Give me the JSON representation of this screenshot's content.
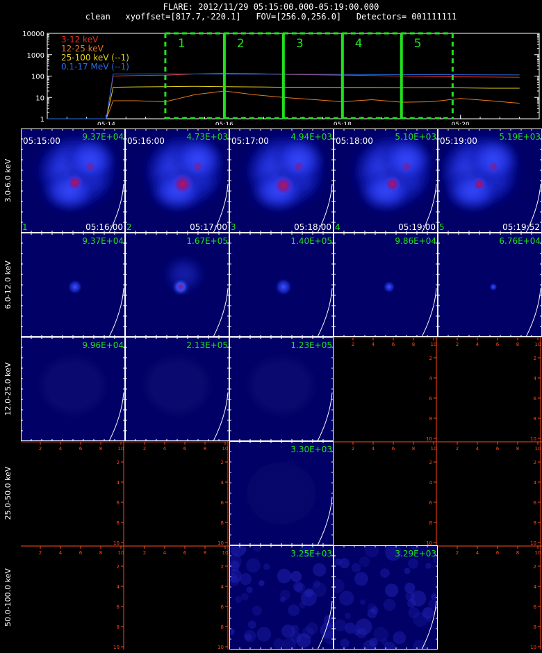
{
  "header": {
    "title_line": "FLARE: 2012/11/29 05:15:00.000-05:19:00.000",
    "info_line": "clean   xyoffset=[817.7,-220.1]   FOV=[256.0,256.0]   Detectors= 001111111"
  },
  "lightcurve": {
    "legend": [
      {
        "label": "3-12 keV",
        "color": "#e8301e"
      },
      {
        "label": "12-25 keV",
        "color": "#e87a1e"
      },
      {
        "label": "25-100 keV (--1)",
        "color": "#e8d51e"
      },
      {
        "label": "0.1-17 MeV (--1)",
        "color": "#2a6ee8"
      }
    ],
    "y_tick_labels": [
      "10000",
      "1000",
      "100",
      "10",
      "1"
    ],
    "x_tick_labels": [
      "05:14",
      "05:16",
      "05:18",
      "05:20"
    ],
    "interval_labels": [
      "1",
      "2",
      "3",
      "4",
      "5"
    ],
    "interval_color": "#22e01e"
  },
  "chart_data": {
    "type": "line",
    "title": "FLARE: 2012/11/29 05:15:00.000-05:19:00.000",
    "y_scale": "log",
    "ylim": [
      1,
      10000
    ],
    "x_unit": "time (UT)",
    "xlim": [
      "05:13:00",
      "05:21:20"
    ],
    "x": [
      "05:13:00",
      "05:13:30",
      "05:14:00",
      "05:14:07",
      "05:14:30",
      "05:15:00",
      "05:15:30",
      "05:16:00",
      "05:16:30",
      "05:17:00",
      "05:17:30",
      "05:18:00",
      "05:18:30",
      "05:19:00",
      "05:19:30",
      "05:20:00",
      "05:20:30",
      "05:21:00"
    ],
    "series": [
      {
        "name": "3-12 keV",
        "color": "#e8301e",
        "values": [
          1,
          1,
          1,
          100,
          105,
          110,
          125,
          135,
          130,
          120,
          115,
          110,
          105,
          100,
          95,
          92,
          90,
          88
        ]
      },
      {
        "name": "12-25 keV",
        "color": "#e87a1e",
        "values": [
          1,
          1,
          1,
          7,
          7,
          7,
          12,
          20,
          15,
          9,
          8,
          7,
          7,
          6,
          7,
          8,
          7,
          6
        ]
      },
      {
        "name": "25-100 keV (--1)",
        "color": "#e8d51e",
        "values": [
          1,
          1,
          1,
          30,
          31,
          32,
          33,
          32,
          31,
          30,
          30,
          29,
          29,
          28,
          28,
          28,
          27,
          27
        ]
      },
      {
        "name": "0.1-17 MeV (--1)",
        "color": "#2a6ee8",
        "values": [
          1,
          1,
          1,
          125,
          125,
          126,
          125,
          124,
          123,
          122,
          121,
          120,
          118,
          117,
          116,
          115,
          114,
          113
        ]
      }
    ],
    "intervals": [
      {
        "label": "1",
        "start": "05:15:00",
        "end": "05:16:00"
      },
      {
        "label": "2",
        "start": "05:16:00",
        "end": "05:17:00"
      },
      {
        "label": "3",
        "start": "05:17:00",
        "end": "05:18:00"
      },
      {
        "label": "4",
        "start": "05:18:00",
        "end": "05:19:00"
      },
      {
        "label": "5",
        "start": "05:19:00",
        "end": "05:19:52"
      }
    ]
  },
  "image_grid": {
    "energy_bands": [
      "3.0-6.0 keV",
      "6.0-12.0 keV",
      "12.0-25.0 keV",
      "25.0-50.0 keV",
      "50.0-100.0 keV"
    ],
    "start_times": [
      "05:15:00",
      "05:16:00",
      "05:17:00",
      "05:18:00",
      "05:19:00"
    ],
    "end_times": [
      "05:16:00",
      "05:17:00",
      "05:18:00",
      "05:19:00",
      "05:19:52"
    ],
    "interval_numbers": [
      "1",
      "2",
      "3",
      "4",
      "5"
    ],
    "peak_values": [
      [
        "9.37E+04",
        "4.73E+03",
        "4.94E+03",
        "5.10E+03",
        "5.19E+03"
      ],
      [
        "9.37E+04",
        "1.67E+05",
        "1.40E+05",
        "9.86E+04",
        "6.76E+04"
      ],
      [
        "9.96E+04",
        "2.13E+05",
        "1.23E+05",
        "",
        ""
      ],
      [
        "",
        "",
        "3.30E+03",
        "",
        ""
      ],
      [
        "",
        "",
        "3.25E+03",
        "3.29E+03",
        ""
      ]
    ],
    "empty_axis_ticks": [
      "2",
      "4",
      "6",
      "8",
      "10"
    ]
  }
}
